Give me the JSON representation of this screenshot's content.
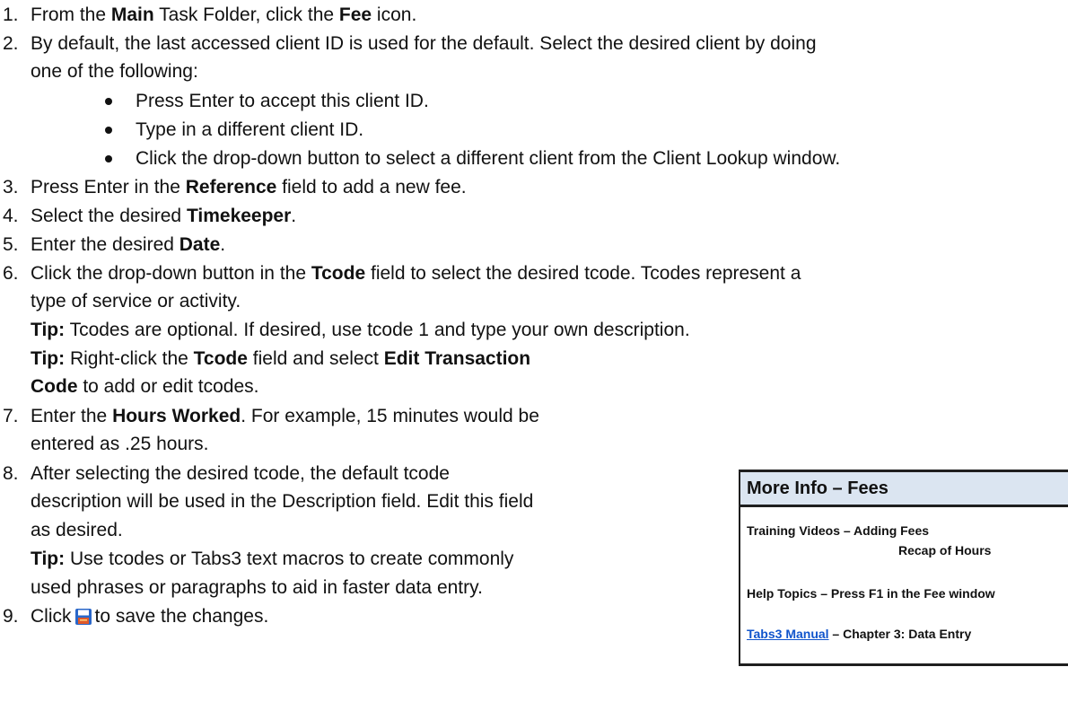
{
  "steps": [
    {
      "number": "1.",
      "parts": [
        {
          "t": "From the "
        },
        {
          "t": "Main",
          "b": true
        },
        {
          "t": " Task Folder, click the "
        },
        {
          "t": "Fee",
          "b": true
        },
        {
          "t": " icon."
        }
      ]
    },
    {
      "number": "2.",
      "lines": [
        "By default, the last accessed client ID is used for the default. Select the desired client by doing",
        "one of the following:"
      ],
      "bullets": [
        "Press Enter to accept this client ID.",
        "Type in a different client ID.",
        "Click the drop-down button to select a different client from the Client Lookup window."
      ]
    },
    {
      "number": "3.",
      "parts": [
        {
          "t": "Press Enter in the "
        },
        {
          "t": "Reference",
          "b": true
        },
        {
          "t": " field to add a new fee."
        }
      ]
    },
    {
      "number": "4.",
      "parts": [
        {
          "t": "Select the desired "
        },
        {
          "t": "Timekeeper",
          "b": true
        },
        {
          "t": "."
        }
      ]
    },
    {
      "number": "5.",
      "parts": [
        {
          "t": "Enter the desired "
        },
        {
          "t": "Date",
          "b": true
        },
        {
          "t": "."
        }
      ]
    },
    {
      "number": "6.",
      "line1": [
        {
          "t": "Click the drop-down button in the "
        },
        {
          "t": "Tcode",
          "b": true
        },
        {
          "t": " field to select the desired tcode. Tcodes represent a"
        }
      ],
      "line2": "type of service or activity.",
      "tip1": [
        {
          "t": "Tip:",
          "b": true
        },
        {
          "t": " Tcodes are optional. If desired, use tcode 1 and type your own description."
        }
      ],
      "tip2a": [
        {
          "t": "Tip:",
          "b": true
        },
        {
          "t": " Right-click the "
        },
        {
          "t": "Tcode",
          "b": true
        },
        {
          "t": " field and select "
        },
        {
          "t": "Edit Transaction",
          "b": true
        }
      ],
      "tip2b": [
        {
          "t": "Code",
          "b": true
        },
        {
          "t": " to add or edit tcodes."
        }
      ]
    },
    {
      "number": "7.",
      "line1": [
        {
          "t": "Enter the "
        },
        {
          "t": "Hours Worked",
          "b": true
        },
        {
          "t": ". For example, 15 minutes would be"
        }
      ],
      "line2": "entered as .25 hours."
    },
    {
      "number": "8.",
      "lines": [
        "After selecting the desired tcode, the default tcode",
        "description will be used in the Description field. Edit this field",
        "as desired."
      ],
      "tip1": [
        {
          "t": "Tip:",
          "b": true
        },
        {
          "t": " Use tcodes or Tabs3 text macros to create commonly"
        }
      ],
      "tip_line2": "used phrases or paragraphs to aid in faster data entry."
    },
    {
      "number": "9.",
      "before": "Click",
      "icon": "save-icon",
      "after": "to save the changes."
    }
  ],
  "info_box": {
    "title": "More Info – Fees",
    "videos_line1": "Training Videos – Adding Fees",
    "videos_line2": "Recap of Hours",
    "help": "Help Topics – Press F1 in the Fee window",
    "manual_link": "Tabs3 Manual",
    "manual_rest": " – Chapter 3:  Data Entry",
    "header_color": "#dbe5f1",
    "link_color": "#1155cc"
  }
}
